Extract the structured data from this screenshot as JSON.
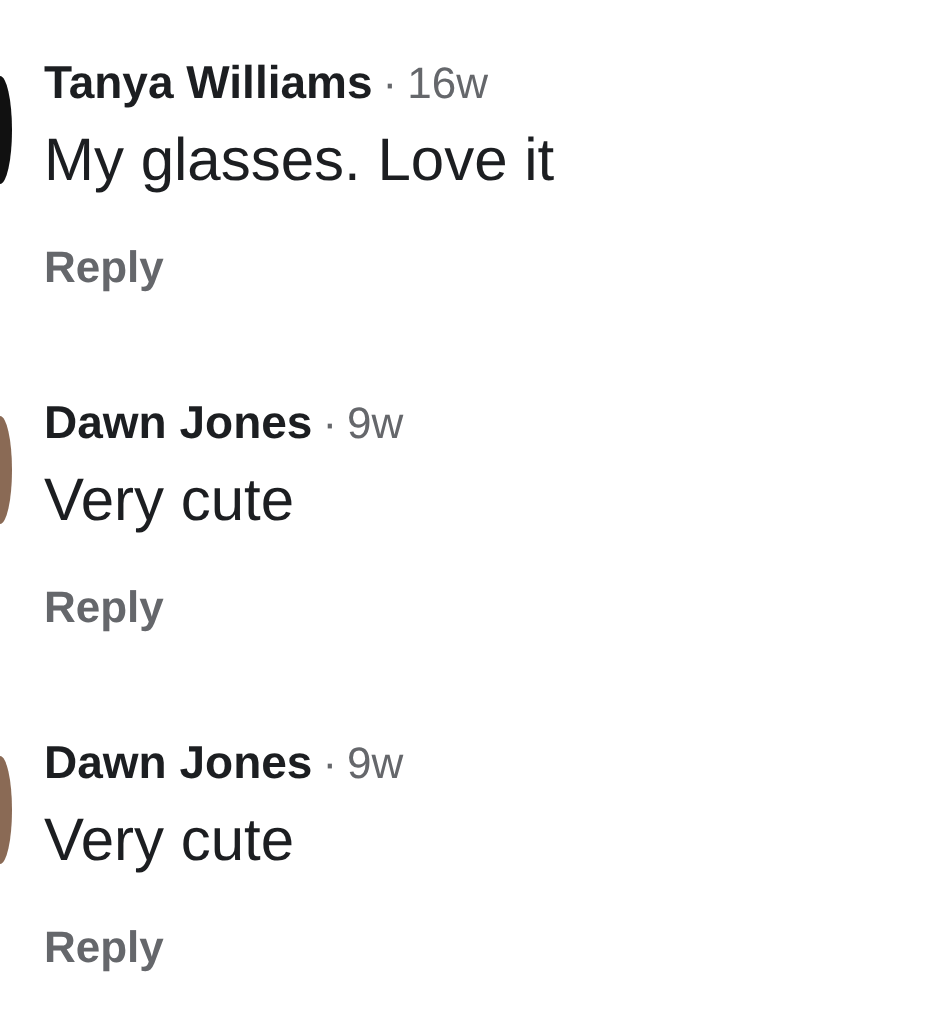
{
  "comments": [
    {
      "author": "Tanya Williams",
      "separator": "·",
      "time": "16w",
      "text": "My glasses. Love it",
      "reply": "Reply",
      "color": "#111111"
    },
    {
      "author": "Dawn Jones",
      "separator": "·",
      "time": "9w",
      "text": "Very cute",
      "reply": "Reply",
      "color": "#8a6a55"
    },
    {
      "author": "Dawn Jones",
      "separator": "·",
      "time": "9w",
      "text": "Very cute",
      "reply": "Reply",
      "color": "#8a6a55"
    }
  ]
}
